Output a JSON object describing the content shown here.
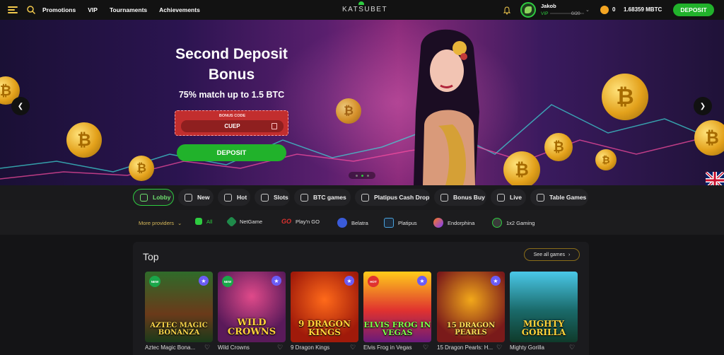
{
  "header": {
    "nav": [
      "Promotions",
      "VIP",
      "Tournaments",
      "Achievements"
    ],
    "logo": "KATSUBET",
    "user": {
      "name": "Jakob",
      "vip_label": "VIP",
      "vip_progress": "0/20"
    },
    "balance_zero": "0",
    "balance": "1.68359 MBTC",
    "deposit_label": "DEPOSIT"
  },
  "hero": {
    "title": "Second Deposit Bonus",
    "subtitle": "75% match up to 1.5 BTC",
    "code_label": "BONUS CODE",
    "code_value": "CUEP",
    "deposit_label": "DEPOSIT",
    "prev_icon": "chevron-left-icon",
    "next_icon": "chevron-right-icon"
  },
  "categories": [
    "Lobby",
    "New",
    "Hot",
    "Slots",
    "BTC games",
    "Platipus Cash Drop",
    "Bonus Buy",
    "Live",
    "Table Games"
  ],
  "providers": {
    "more_label": "More providers",
    "items": [
      "All",
      "NetGame",
      "Play'n GO",
      "Belatra",
      "Platipus",
      "Endorphina",
      "1x2 Gaming"
    ]
  },
  "top": {
    "title": "Top",
    "see_all": "See all games",
    "games": [
      {
        "name": "Aztec Magic Bona...",
        "art_title": "AZTEC MAGIC BONANZA",
        "badge": "NEW"
      },
      {
        "name": "Wild Crowns",
        "art_title": "WILD CROWNS",
        "badge": "NEW"
      },
      {
        "name": "9 Dragon Kings",
        "art_title": "9 DRAGON KINGS",
        "badge": ""
      },
      {
        "name": "Elvis Frog in Vegas",
        "art_title": "ELVIS FROG IN VEGAS",
        "badge": "HOT"
      },
      {
        "name": "15 Dragon Pearls: H...",
        "art_title": "15 DRAGON PEARLS",
        "badge": ""
      },
      {
        "name": "Mighty Gorilla",
        "art_title": "MIGHTY GORILLA",
        "badge": ""
      }
    ]
  },
  "colors": {
    "accent_green": "#21b22b",
    "gold": "#f2c94c"
  }
}
